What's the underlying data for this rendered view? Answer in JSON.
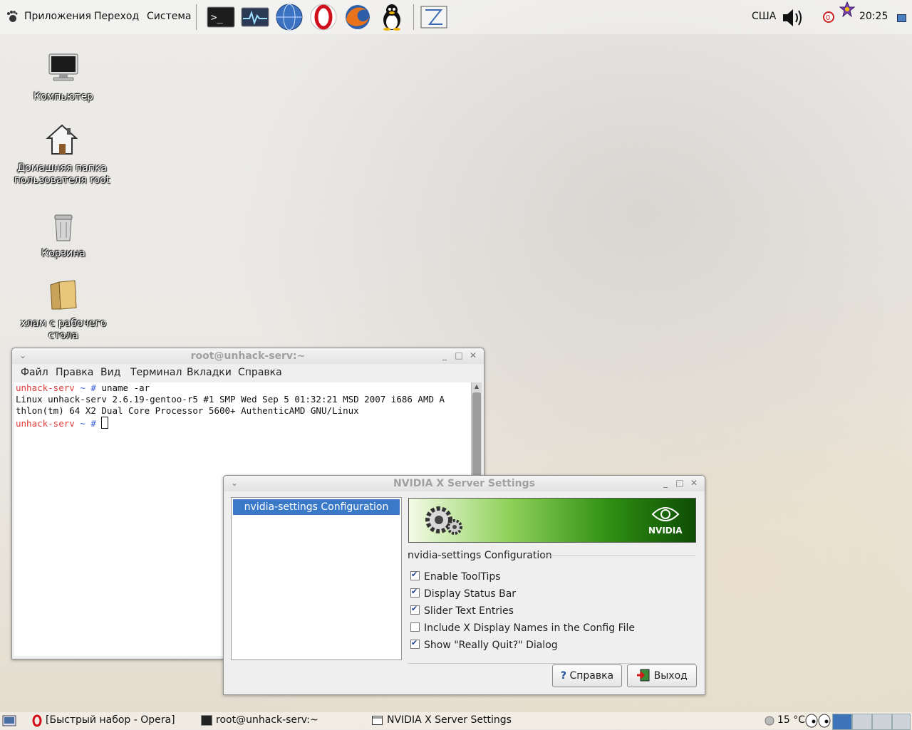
{
  "top_panel": {
    "menus": [
      "Приложения",
      "Переход",
      "Система"
    ],
    "launchers": [
      "terminal-icon",
      "system-monitor-icon",
      "network-globe-icon",
      "opera-icon",
      "firefox-icon",
      "tux-icon",
      "screenshot-icon"
    ],
    "keyboard_layout": "США",
    "clock": "20:25"
  },
  "desktop": {
    "icons": [
      {
        "label": "Компьютер"
      },
      {
        "label": "Домашняя папка\nпользователя root"
      },
      {
        "label": "Корзина"
      },
      {
        "label": "хлам с рабочего\nстола"
      }
    ]
  },
  "terminal": {
    "title": "root@unhack-serv:~",
    "menu": [
      "Файл",
      "Правка",
      "Вид",
      "Терминал",
      "Вкладки",
      "Справка"
    ],
    "prompt_host": "unhack-serv",
    "prompt_path": "~ #",
    "command": " uname -ar",
    "output_1": "Linux unhack-serv 2.6.19-gentoo-r5 #1 SMP Wed Sep 5 01:32:21 MSD 2007 i686 AMD A",
    "output_2": "thlon(tm) 64 X2 Dual Core Processor 5600+ AuthenticAMD GNU/Linux"
  },
  "nvidia": {
    "title": "NVIDIA X Server Settings",
    "list_item": "nvidia-settings Configuration",
    "banner_brand": "NVIDIA",
    "section": "nvidia-settings Configuration",
    "options": [
      {
        "label": "Enable ToolTips",
        "checked": true
      },
      {
        "label": "Display Status Bar",
        "checked": true
      },
      {
        "label": "Slider Text Entries",
        "checked": true
      },
      {
        "label": "Include X Display Names in the Config File",
        "checked": false
      },
      {
        "label": "Show \"Really Quit?\" Dialog",
        "checked": true
      }
    ],
    "help_button": "Справка",
    "quit_button": "Выход"
  },
  "bottom_panel": {
    "tasks": [
      "[Быстрый набор - Opera]",
      "root@unhack-serv:~",
      "NVIDIA X Server Settings"
    ],
    "temperature": "15 °C"
  }
}
